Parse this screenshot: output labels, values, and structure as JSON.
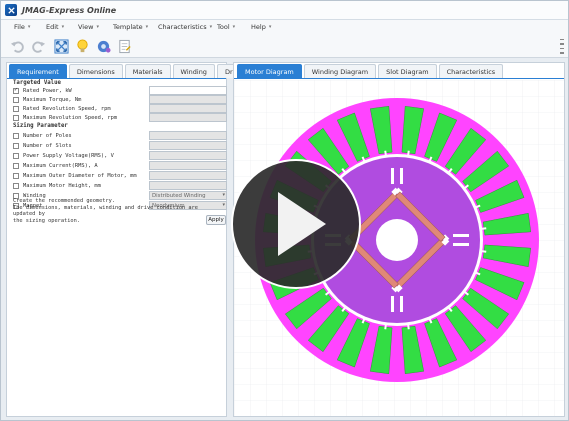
{
  "app": {
    "title": "JMAG-Express Online"
  },
  "menu": [
    {
      "label": "File"
    },
    {
      "label": "Edit"
    },
    {
      "label": "View"
    },
    {
      "label": "Template"
    },
    {
      "label": "Characteristics"
    },
    {
      "label": "Tool"
    },
    {
      "label": "Help"
    }
  ],
  "toolbar": {
    "icons": [
      "undo-icon",
      "redo-icon",
      "fit-view-icon",
      "lightbulb-icon",
      "settings-icon",
      "report-icon"
    ]
  },
  "left_tabs": [
    {
      "label": "Requirement",
      "active": true
    },
    {
      "label": "Dimensions",
      "active": false
    },
    {
      "label": "Materials",
      "active": false
    },
    {
      "label": "Winding",
      "active": false
    },
    {
      "label": "Drive",
      "active": false
    }
  ],
  "targeted_value": {
    "title": "Targeted Value",
    "items": [
      {
        "label": "Rated Power, kW",
        "checked": true,
        "value": ""
      },
      {
        "label": "Maximum Torque, Nm",
        "checked": false,
        "value": ""
      },
      {
        "label": "Rated Revolution Speed, rpm",
        "checked": false,
        "value": ""
      },
      {
        "label": "Maximum Revolution Speed, rpm",
        "checked": false,
        "value": ""
      }
    ]
  },
  "sizing_parameter": {
    "title": "Sizing Parameter",
    "items": [
      {
        "label": "Number of Poles",
        "checked": false,
        "value": ""
      },
      {
        "label": "Number of Slots",
        "checked": false,
        "value": ""
      },
      {
        "label": "Power Supply Voltage(RMS), V",
        "checked": false,
        "value": ""
      },
      {
        "label": "Maximum Current(RMS), A",
        "checked": false,
        "value": ""
      },
      {
        "label": "Maximum Outer Diameter of Motor, mm",
        "checked": false,
        "value": ""
      },
      {
        "label": "Maximum Motor Height, mm",
        "checked": false,
        "value": ""
      },
      {
        "label": "Winding",
        "checked": false,
        "value": "Distributed Winding"
      },
      {
        "label": "Magnet",
        "checked": false,
        "value": "Neodymium"
      }
    ]
  },
  "note": {
    "line1": "Create the recommended geometry.",
    "line2": "The dimensions, materials, winding and drive condition are updated by",
    "line3": "the sizing operation."
  },
  "apply_label": "Apply",
  "right_tabs": [
    {
      "label": "Motor Diagram",
      "active": true
    },
    {
      "label": "Winding Diagram",
      "active": false
    },
    {
      "label": "Slot Diagram",
      "active": false
    },
    {
      "label": "Characteristics",
      "active": false
    }
  ],
  "motor_diagram": {
    "stator_color": "#ff44ff",
    "coil_color": "#33dd44",
    "rotor_color": "#b04ce0",
    "magnet_color": "#e08878",
    "slot_count": 24,
    "pole_count": 4
  },
  "icons": {
    "play": "play-icon",
    "dropdown": "chevron-down-icon"
  }
}
